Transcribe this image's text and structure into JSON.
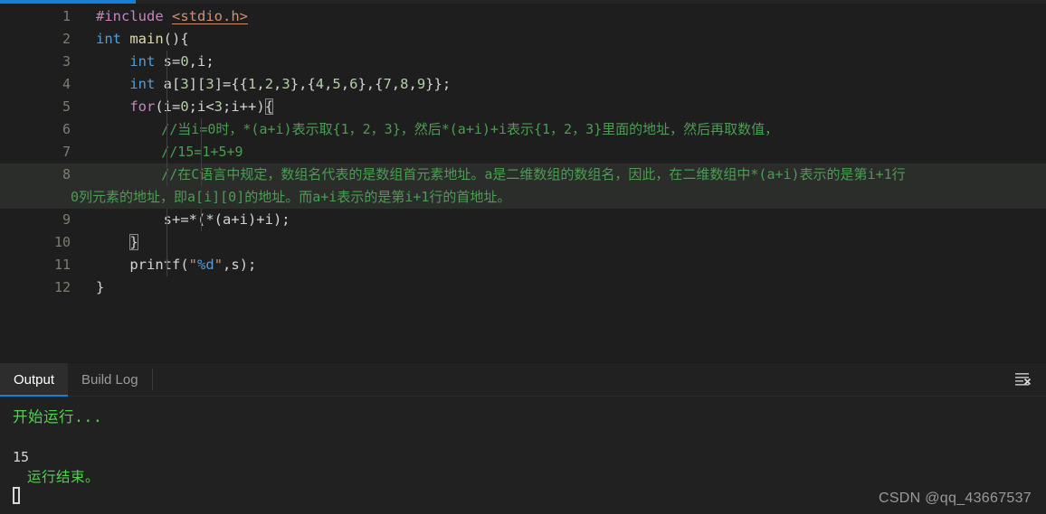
{
  "window": {
    "theme_bg": "#1e1e1e",
    "accent_color": "#1a7fd4"
  },
  "editor": {
    "language": "c",
    "lines": [
      {
        "no": "1",
        "text": "#include <stdio.h>"
      },
      {
        "no": "2",
        "text": "int main(){"
      },
      {
        "no": "3",
        "text": "    int s=0,i;"
      },
      {
        "no": "4",
        "text": "    int a[3][3]={{1,2,3},{4,5,6},{7,8,9}};"
      },
      {
        "no": "5",
        "text": "    for(i=0;i<3;i++){"
      },
      {
        "no": "6",
        "text": "        //当i=0时，*(a+i)表示取{1，2，3}，然后*(a+i)+i表示{1，2，3}里面的地址，然后再取数值，"
      },
      {
        "no": "7",
        "text": "        //15=1+5+9"
      },
      {
        "no": "8",
        "text": "        //在C语言中规定，数组名代表的是数组首元素地址。a是二维数组的数组名，因此，在二维数组中*(a+i)表示的是第i+1行"
      },
      {
        "no": "8b",
        "text": "0列元素的地址，即a[i][0]的地址。而a+i表示的是第i+1行的首地址。"
      },
      {
        "no": "9",
        "text": "        s+=*(*(a+i)+i);"
      },
      {
        "no": "10",
        "text": "    }"
      },
      {
        "no": "11",
        "text": "    printf(\"%d\",s);"
      },
      {
        "no": "12",
        "text": "}"
      }
    ],
    "tokens": {
      "l1_include": "#include",
      "l1_header": "<stdio.h>",
      "l2_type": "int",
      "l2_fn": "main",
      "l2_rest": "(){",
      "l3_type": "int",
      "l3_rest_a": " s=",
      "l3_num": "0",
      "l3_rest_b": ",i;",
      "l4_type": "int",
      "l4_name": " a[",
      "l4_n3a": "3",
      "l4_mid": "][",
      "l4_n3b": "3",
      "l4_eq": "]={{",
      "l4_n1": "1",
      "l4_c1": ",",
      "l4_n2": "2",
      "l4_c2": ",",
      "l4_n3": "3",
      "l4_c3": "},{",
      "l4_n4": "4",
      "l4_c4": ",",
      "l4_n5": "5",
      "l4_c5": ",",
      "l4_n6": "6",
      "l4_c6": "},{",
      "l4_n7": "7",
      "l4_c7": ",",
      "l4_n8": "8",
      "l4_c8": ",",
      "l4_n9": "9",
      "l4_end": "}};",
      "l5_kw": "for",
      "l5_a": "(i=",
      "l5_n0": "0",
      "l5_b": ";i<",
      "l5_n3": "3",
      "l5_c": ";i++)",
      "l5_brace": "{",
      "l6_comment": "//当i=0时，*(a+i)表示取{1，2，3}，然后*(a+i)+i表示{1，2，3}里面的地址，然后再取数值，",
      "l7_comment": "//15=1+5+9",
      "l8_comment": "//在C语言中规定，数组名代表的是数组首元素地址。a是二维数组的数组名，因此，在二维数组中*(a+i)表示的是第i+1行",
      "l8_wrap": "0列元素的地址，即a[i][0]的地址。而a+i表示的是第i+1行的首地址。",
      "l9_code": "s+=*(*(a+i)+i);",
      "l10_brace": "}",
      "l11_fn": "printf",
      "l11_open": "(",
      "l11_q1": "\"",
      "l11_fmt": "%d",
      "l11_q2": "\"",
      "l11_args": ",s);",
      "l12_brace": "}"
    }
  },
  "panel": {
    "tabs": [
      {
        "label": "Output",
        "active": true
      },
      {
        "label": "Build Log",
        "active": false
      }
    ],
    "clear_icon": "clear-output-icon",
    "console": {
      "start_text": "开始运行...",
      "result_value": "15",
      "end_text": "运行结束。",
      "cursor": "block-cursor"
    }
  },
  "watermark": {
    "text": "CSDN @qq_43667537"
  }
}
